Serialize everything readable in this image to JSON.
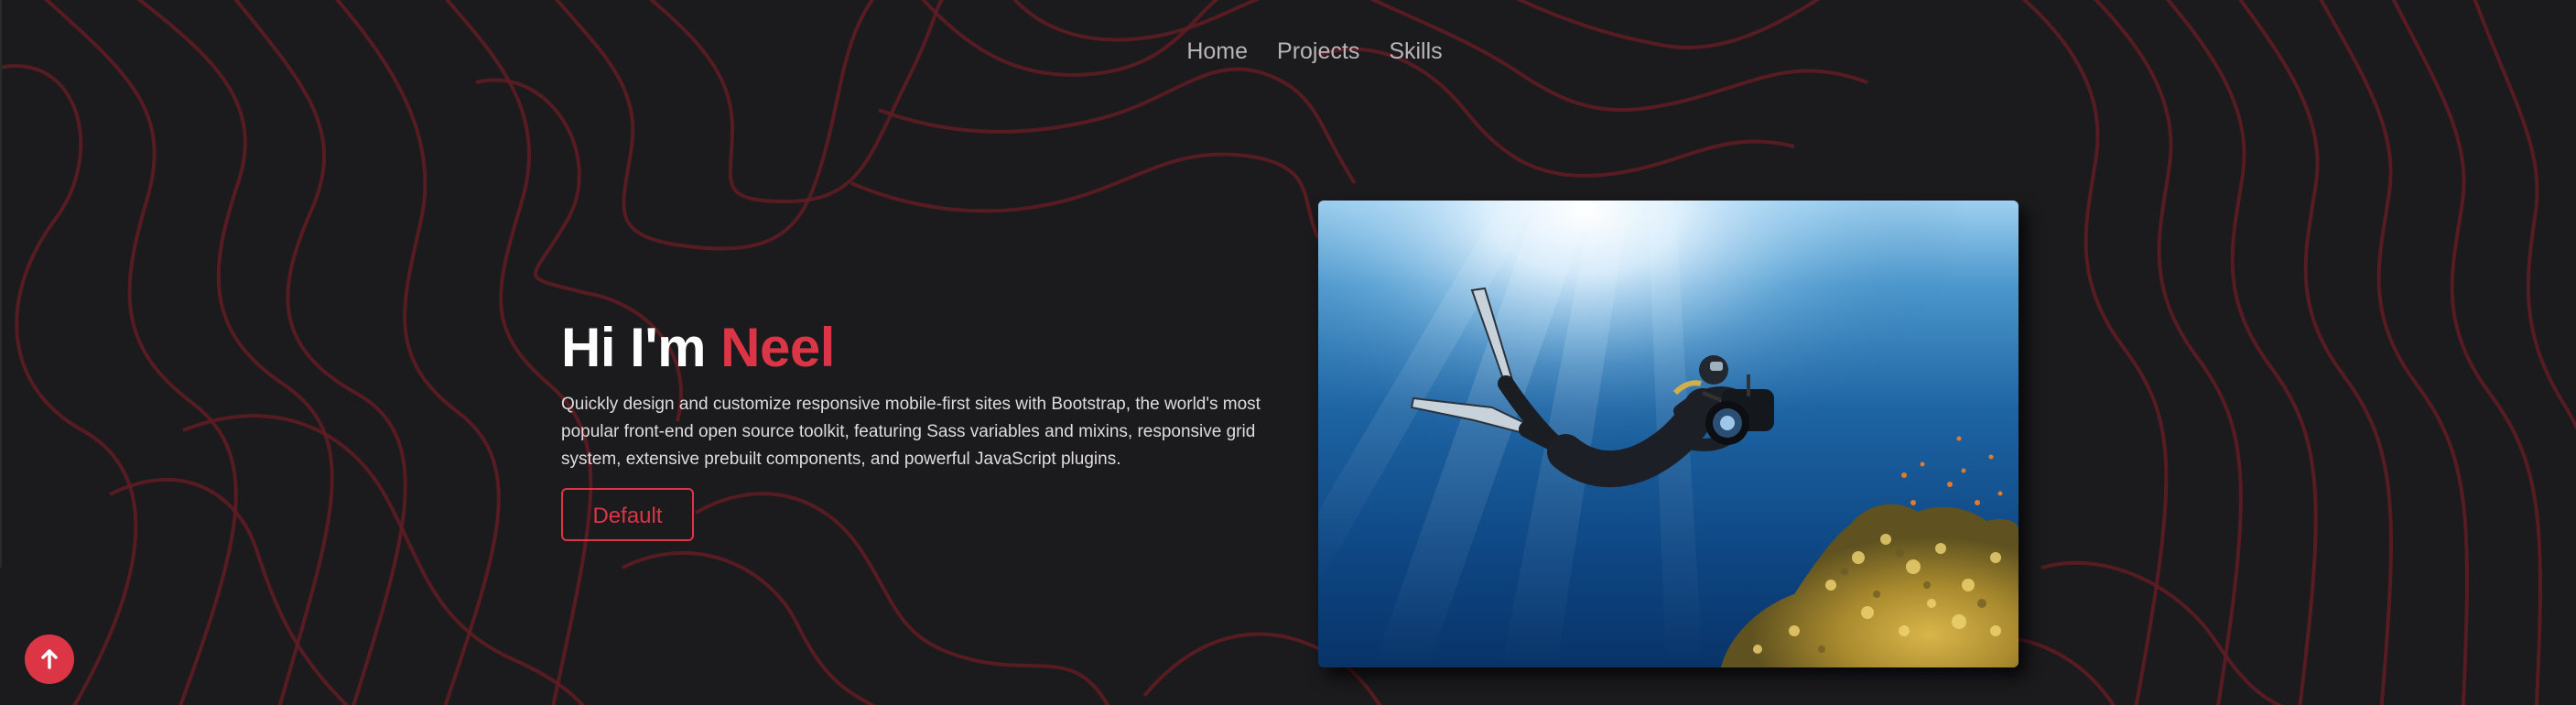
{
  "nav": {
    "items": [
      {
        "label": "Home"
      },
      {
        "label": "Projects"
      },
      {
        "label": "Skills"
      }
    ]
  },
  "hero": {
    "title_prefix": "Hi I'm",
    "title_name": "Neel",
    "description": "Quickly design and customize responsive mobile-first sites with Bootstrap, the world's most popular front-end open source toolkit, featuring Sass variables and mixins, responsive grid system, extensive prebuilt components, and powerful JavaScript plugins.",
    "button_label": "Default"
  },
  "image": {
    "subject": "underwater-photographer-diver"
  },
  "scroll_top": {
    "icon": "arrow-up-icon"
  },
  "colors": {
    "background": "#1b1a1d",
    "accent": "#dc3545",
    "pattern": "#5d1d24",
    "nav_text": "#b7b5b8"
  }
}
